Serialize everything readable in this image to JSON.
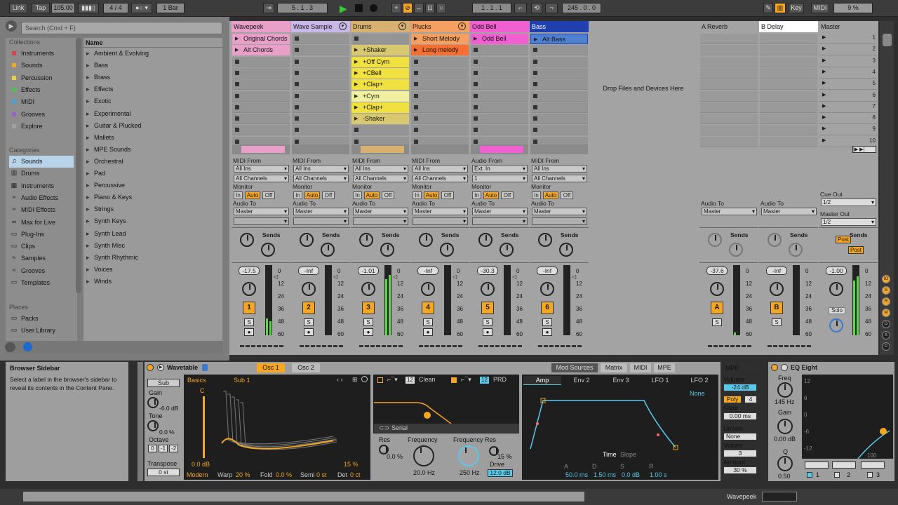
{
  "topbar": {
    "link": "Link",
    "tap": "Tap",
    "tempo": "105.00",
    "time_sig": "4 / 4",
    "quant": "1 Bar",
    "position": "5 .  1 .  3",
    "loop_start": "1 .  1 .  1",
    "loop_len": "245 .  0 .  0",
    "key": "Key",
    "midi": "MIDI",
    "cpu": "9 %"
  },
  "browser": {
    "search_placeholder": "Search (Cmd + F)",
    "collections_title": "Collections",
    "collections": [
      {
        "label": "Instruments",
        "color": "#e04040"
      },
      {
        "label": "Sounds",
        "color": "#f5a623"
      },
      {
        "label": "Percussion",
        "color": "#e8d040"
      },
      {
        "label": "Effects",
        "color": "#50c050"
      },
      {
        "label": "MIDI",
        "color": "#40a0e0"
      },
      {
        "label": "Grooves",
        "color": "#a060d0"
      },
      {
        "label": "Explore",
        "color": "#a0a0a0"
      }
    ],
    "categories_title": "Categories",
    "categories": [
      "Sounds",
      "Drums",
      "Instruments",
      "Audio Effects",
      "MIDI Effects",
      "Max for Live",
      "Plug-Ins",
      "Clips",
      "Samples",
      "Grooves",
      "Templates"
    ],
    "places_title": "Places",
    "places": [
      "Packs",
      "User Library"
    ],
    "name_header": "Name",
    "names": [
      "Ambient & Evolving",
      "Bass",
      "Brass",
      "Effects",
      "Exotic",
      "Experimental",
      "Guitar & Plucked",
      "Mallets",
      "MPE Sounds",
      "Orchestral",
      "Pad",
      "Percussive",
      "Piano & Keys",
      "Strings",
      "Synth Keys",
      "Synth Lead",
      "Synth Misc",
      "Synth Rhythmic",
      "Voices",
      "Winds"
    ]
  },
  "tracks": [
    {
      "name": "Wavepeek",
      "color": "#e8a0c8",
      "clips": [
        {
          "label": "Original Chords",
          "color": "#e8a0c8"
        },
        {
          "label": "Alt Chords",
          "color": "#e8a0c8"
        }
      ],
      "vol": "-17.5",
      "num": "1"
    },
    {
      "name": "Wave Sample",
      "color": "#c8b8e8",
      "clips": [],
      "vol": "-Inf",
      "num": "2"
    },
    {
      "name": "Drums",
      "color": "#d8b070",
      "clips": [
        {
          "label": "+Shaker",
          "color": "#d8c870",
          "row": 1
        },
        {
          "label": "+Off Cym",
          "color": "#f0e040",
          "row": 2
        },
        {
          "label": "+CBell",
          "color": "#f0e040",
          "row": 3
        },
        {
          "label": "+Clap+",
          "color": "#f0e040",
          "row": 4
        },
        {
          "label": "+Cym",
          "color": "#f0f0a0",
          "row": 5
        },
        {
          "label": "+Clap+",
          "color": "#f0e040",
          "row": 6
        },
        {
          "label": "-Shaker",
          "color": "#d8c870",
          "row": 7
        }
      ],
      "vol": "-1.01",
      "num": "3"
    },
    {
      "name": "Plucks",
      "color": "#f5a060",
      "clips": [
        {
          "label": "Short Melody",
          "color": "#f5a060"
        },
        {
          "label": "Long melody",
          "color": "#f57030"
        }
      ],
      "vol": "-Inf",
      "num": "4"
    },
    {
      "name": "Odd Bell",
      "color": "#f060d0",
      "clips": [
        {
          "label": "Odd Bell",
          "color": "#f060d0"
        }
      ],
      "vol": "-30.3",
      "num": "5"
    },
    {
      "name": "Bass",
      "color": "#2040b0",
      "clips": [
        {
          "label": "Alt Bass",
          "color": "#5080d0"
        }
      ],
      "vol": "-Inf",
      "num": "6"
    }
  ],
  "io": {
    "midi_from": "MIDI From",
    "all_ins": "All Ins",
    "all_channels": "All Channels",
    "monitor": "Monitor",
    "in": "In",
    "auto": "Auto",
    "off": "Off",
    "audio_to": "Audio To",
    "master": "Master",
    "audio_from": "Audio From",
    "ext_in": "Ext. In",
    "one": "1",
    "sends": "Sends"
  },
  "drop_text": "Drop Files and Devices Here",
  "returns": [
    {
      "name": "A Reverb",
      "vol": "-37.6",
      "letter": "A"
    },
    {
      "name": "B Delay",
      "vol": "-Inf",
      "letter": "B"
    }
  ],
  "master": {
    "name": "Master",
    "vol": "-1.00",
    "cue_out": "Cue Out",
    "master_out": "Master Out",
    "ch": "1/2",
    "post": "Post",
    "solo": "Solo",
    "scenes": [
      "1",
      "2",
      "3",
      "4",
      "5",
      "6",
      "7",
      "8",
      "9",
      "10"
    ]
  },
  "scale": [
    "0",
    "12",
    "24",
    "36",
    "48",
    "60"
  ],
  "info": {
    "title": "Browser Sidebar",
    "text": "Select a label in the browser's sidebar to reveal its contents in the Content Pane."
  },
  "wavetable": {
    "title": "Wavetable",
    "osc1": "Osc 1",
    "osc2": "Osc 2",
    "sub": "Sub",
    "gain": "Gain",
    "gain_val": "-6.0 dB",
    "tone": "Tone",
    "tone_val": "0.0 %",
    "octave": "Octave",
    "oct_vals": [
      "0",
      "-1",
      "-2"
    ],
    "transpose": "Transpose",
    "transpose_val": "0 st",
    "basics": "Basics",
    "sub1": "Sub 1",
    "c": "C",
    "db": "0.0 dB",
    "pct": "15 %",
    "modern": "Modern",
    "warp": "Warp",
    "warp_val": "20 %",
    "fold": "Fold",
    "fold_val": "0.0 %",
    "semi": "Semi",
    "semi_val": "0 st",
    "det": "Det",
    "det_val": "0 ct",
    "f12": "12",
    "clean": "Clean",
    "f12b": "12",
    "prd": "PRD",
    "serial": "Serial",
    "res": "Res",
    "res_val": "0.0 %",
    "freq": "Frequency",
    "freq_val": "20.0 Hz",
    "freqres": "Frequency Res",
    "freq2_val": "250 Hz",
    "drive_pct": "15 %",
    "drive": "Drive",
    "drive_val": "12.0 dB",
    "modsrc": "Mod Sources",
    "matrix": "Matrix",
    "midi": "MIDI",
    "mpe": "MPE",
    "amp": "Amp",
    "env2": "Env 2",
    "env3": "Env 3",
    "lfo1": "LFO 1",
    "lfo2": "LFO 2",
    "none": "None",
    "time": "Time",
    "slope": "Slope",
    "a": "A",
    "d": "D",
    "s": "S",
    "r": "R",
    "a_val": "50.0 ms",
    "d_val": "1.50 ms",
    "s_val": "0.0 dB",
    "r_val": "1.00 s",
    "mpe_label": "MPE",
    "volume": "Volume",
    "volume_val": "-24 dB",
    "poly": "Poly",
    "voices_n": "4",
    "glide": "Glide",
    "glide_val": "0.00 ms",
    "unison": "Unison",
    "unison_val": "None",
    "voices": "Voices",
    "voices_val": "3",
    "amount": "Amount",
    "amount_val": "30 %"
  },
  "eq": {
    "title": "EQ Eight",
    "freq": "Freq",
    "freq_val": "145 Hz",
    "gain": "Gain",
    "gain_val": "0.00 dB",
    "q": "Q",
    "q_val": "0.50",
    "scale": [
      "12",
      "6",
      "0",
      "-6",
      "-12"
    ],
    "k100": "100",
    "b1": "1",
    "b2": "2",
    "b3": "3"
  },
  "status": {
    "track": "Wavepeek"
  }
}
